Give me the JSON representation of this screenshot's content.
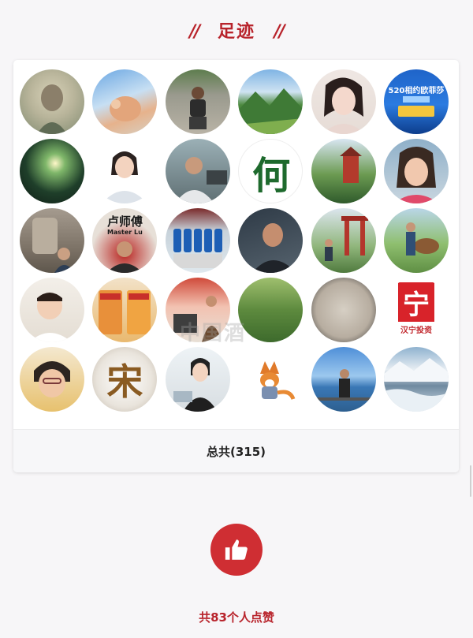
{
  "section": {
    "slash_left": "//",
    "title": "足迹",
    "slash_right": "//"
  },
  "avatars": [
    {
      "text": ""
    },
    {
      "text": ""
    },
    {
      "text": ""
    },
    {
      "text": ""
    },
    {
      "text": ""
    },
    {
      "text": "520相约欧菲莎"
    },
    {
      "text": ""
    },
    {
      "text": ""
    },
    {
      "text": ""
    },
    {
      "text": "何"
    },
    {
      "text": ""
    },
    {
      "text": ""
    },
    {
      "text": ""
    },
    {
      "text": "卢师傅",
      "sub": "Master Lu"
    },
    {
      "text": ""
    },
    {
      "text": ""
    },
    {
      "text": ""
    },
    {
      "text": ""
    },
    {
      "text": ""
    },
    {
      "text": ""
    },
    {
      "text": ""
    },
    {
      "text": ""
    },
    {
      "text": ""
    },
    {
      "text": "宁",
      "sub": "汉宁投资"
    },
    {
      "text": ""
    },
    {
      "text": "宋"
    },
    {
      "text": ""
    },
    {
      "text": ""
    },
    {
      "text": ""
    },
    {
      "text": ""
    }
  ],
  "watermark": "中国酒",
  "footer": {
    "total_label": "总共(315)"
  },
  "like": {
    "icon": "thumbs-up-icon",
    "count_label": "共83个人点赞"
  },
  "colors": {
    "accent": "#b8232b",
    "like_bg": "#cf2e33"
  }
}
